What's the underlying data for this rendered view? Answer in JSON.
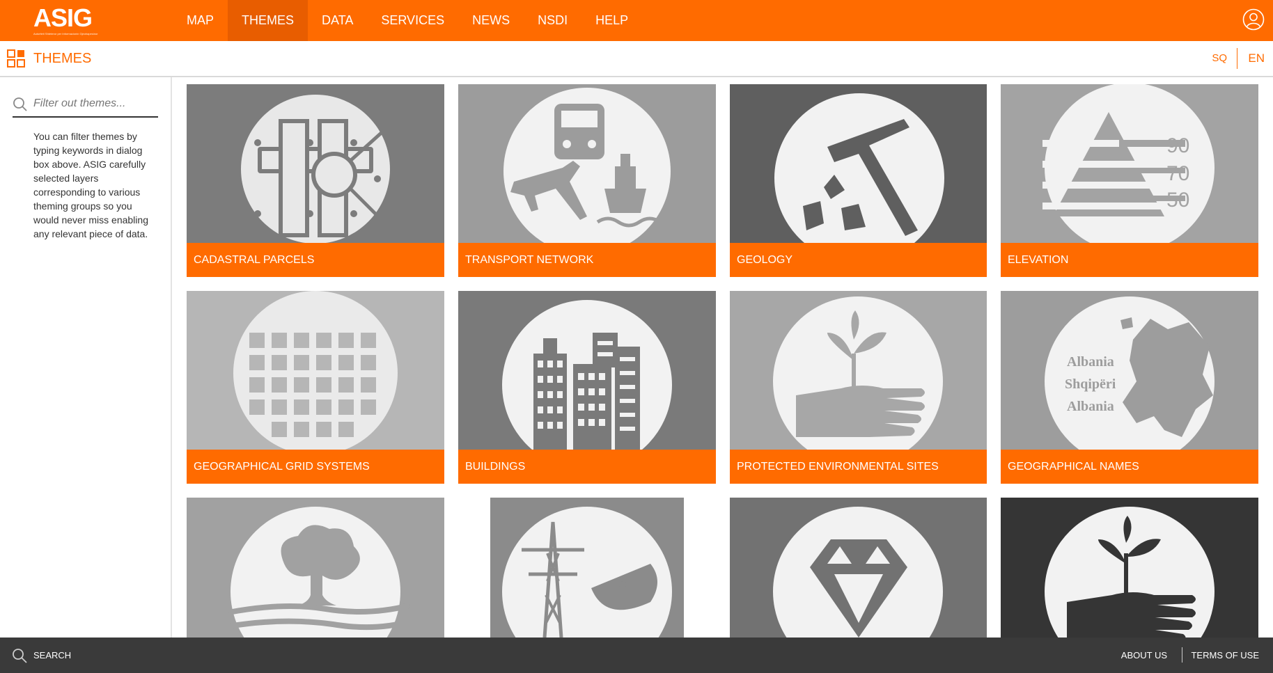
{
  "header": {
    "logo_text": "ASIG",
    "logo_subtext": "Autoriteti Shteteror per Informacionin Gjeohapesinor",
    "nav": [
      {
        "label": "MAP"
      },
      {
        "label": "THEMES",
        "active": true
      },
      {
        "label": "DATA"
      },
      {
        "label": "SERVICES"
      },
      {
        "label": "NEWS"
      },
      {
        "label": "NSDI"
      },
      {
        "label": "HELP"
      }
    ],
    "user_icon": "user-icon"
  },
  "subheader": {
    "title": "THEMES",
    "icon": "grid-icon",
    "languages": [
      "SQ",
      "EN"
    ]
  },
  "sidebar": {
    "filter_placeholder": "Filter out themes...",
    "help_text": "You can filter themes by typing keywords in dialog box above. ASIG carefully selected layers corresponding to various theming groups so you would never miss enabling any relevant piece of data."
  },
  "themes": [
    {
      "label": "CADASTRAL PARCELS",
      "icon": "cadastral-parcels-icon"
    },
    {
      "label": "TRANSPORT NETWORK",
      "icon": "transport-network-icon"
    },
    {
      "label": "GEOLOGY",
      "icon": "geology-hammer-icon"
    },
    {
      "label": "ELEVATION",
      "icon": "elevation-icon",
      "numbers": [
        "90",
        "70",
        "50"
      ]
    },
    {
      "label": "GEOGRAPHICAL GRID SYSTEMS",
      "icon": "grid-globe-icon"
    },
    {
      "label": "BUILDINGS",
      "icon": "buildings-icon"
    },
    {
      "label": "PROTECTED ENVIRONMENTAL SITES",
      "icon": "hand-plant-icon"
    },
    {
      "label": "GEOGRAPHICAL NAMES",
      "icon": "europe-map-icon",
      "names": [
        "Albania",
        "Shqipëri",
        "Albania"
      ]
    },
    {
      "label": "",
      "icon": "tree-fields-icon"
    },
    {
      "label": "",
      "icon": "utility-tower-dish-icon"
    },
    {
      "label": "",
      "icon": "diamond-icon"
    },
    {
      "label": "",
      "icon": "hand-plant-dark-icon"
    }
  ],
  "footer": {
    "search_label": "SEARCH",
    "about_label": "ABOUT US",
    "terms_label": "TERMS OF USE"
  },
  "colors": {
    "accent": "#ff6b00",
    "accent_dark": "#e85d00",
    "footer_bg": "#3a3a3a"
  }
}
